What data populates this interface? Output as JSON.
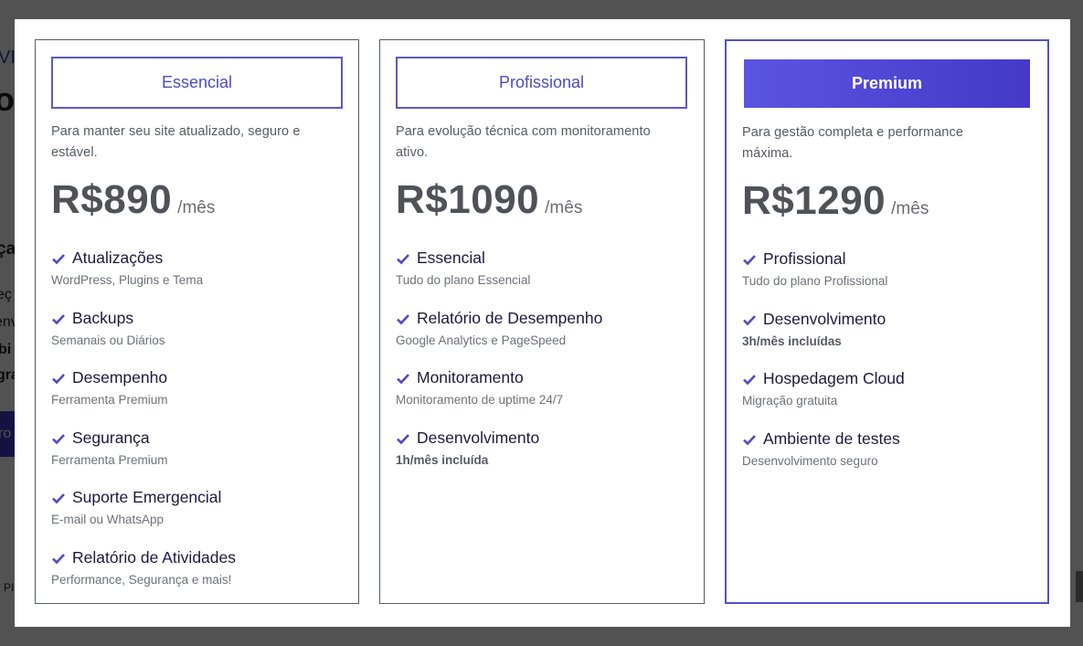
{
  "colors": {
    "accent": "#5250c9",
    "heading": "#1a1a40",
    "muted": "#6d7177",
    "price": "#4f5257"
  },
  "plans": [
    {
      "name": "Essencial",
      "description": "Para manter seu site atualizado, seguro e estável.",
      "price": "R$890",
      "period": "/mês",
      "features": [
        {
          "title": "Atualizações",
          "sub": "WordPress, Plugins e Tema",
          "bold": false
        },
        {
          "title": "Backups",
          "sub": "Semanais ou Diários",
          "bold": false
        },
        {
          "title": "Desempenho",
          "sub": "Ferramenta Premium",
          "bold": false
        },
        {
          "title": "Segurança",
          "sub": "Ferramenta Premium",
          "bold": false
        },
        {
          "title": "Suporte Emergencial",
          "sub": "E-mail ou WhatsApp",
          "bold": false
        },
        {
          "title": "Relatório de Atividades",
          "sub": "Performance, Segurança e mais!",
          "bold": false
        }
      ]
    },
    {
      "name": "Profissional",
      "description": "Para evolução técnica com monitoramento ativo.",
      "price": "R$1090",
      "period": "/mês",
      "features": [
        {
          "title": "Essencial",
          "sub": "Tudo do plano Essencial",
          "bold": false
        },
        {
          "title": "Relatório de Desempenho",
          "sub": "Google Analytics e PageSpeed",
          "bold": false
        },
        {
          "title": "Monitoramento",
          "sub": "Monitoramento de uptime 24/7",
          "bold": false
        },
        {
          "title": "Desenvolvimento",
          "sub": "1h/mês incluída",
          "bold": true
        }
      ]
    },
    {
      "name": "Premium",
      "description": "Para gestão completa e performance máxima.",
      "price": "R$1290",
      "period": "/mês",
      "features": [
        {
          "title": "Profissional",
          "sub": "Tudo do plano Profissional",
          "bold": false
        },
        {
          "title": "Desenvolvimento",
          "sub": "3h/mês incluídas",
          "bold": true
        },
        {
          "title": "Hospedagem Cloud",
          "sub": "Migração gratuita",
          "bold": false
        },
        {
          "title": "Ambiente de testes",
          "sub": "Desenvolvimento seguro",
          "bold": false
        }
      ]
    }
  ],
  "background_fragments": [
    "VI",
    "or",
    "ça",
    "eç",
    "env",
    "bi",
    "gra",
    "ro",
    "PI"
  ]
}
